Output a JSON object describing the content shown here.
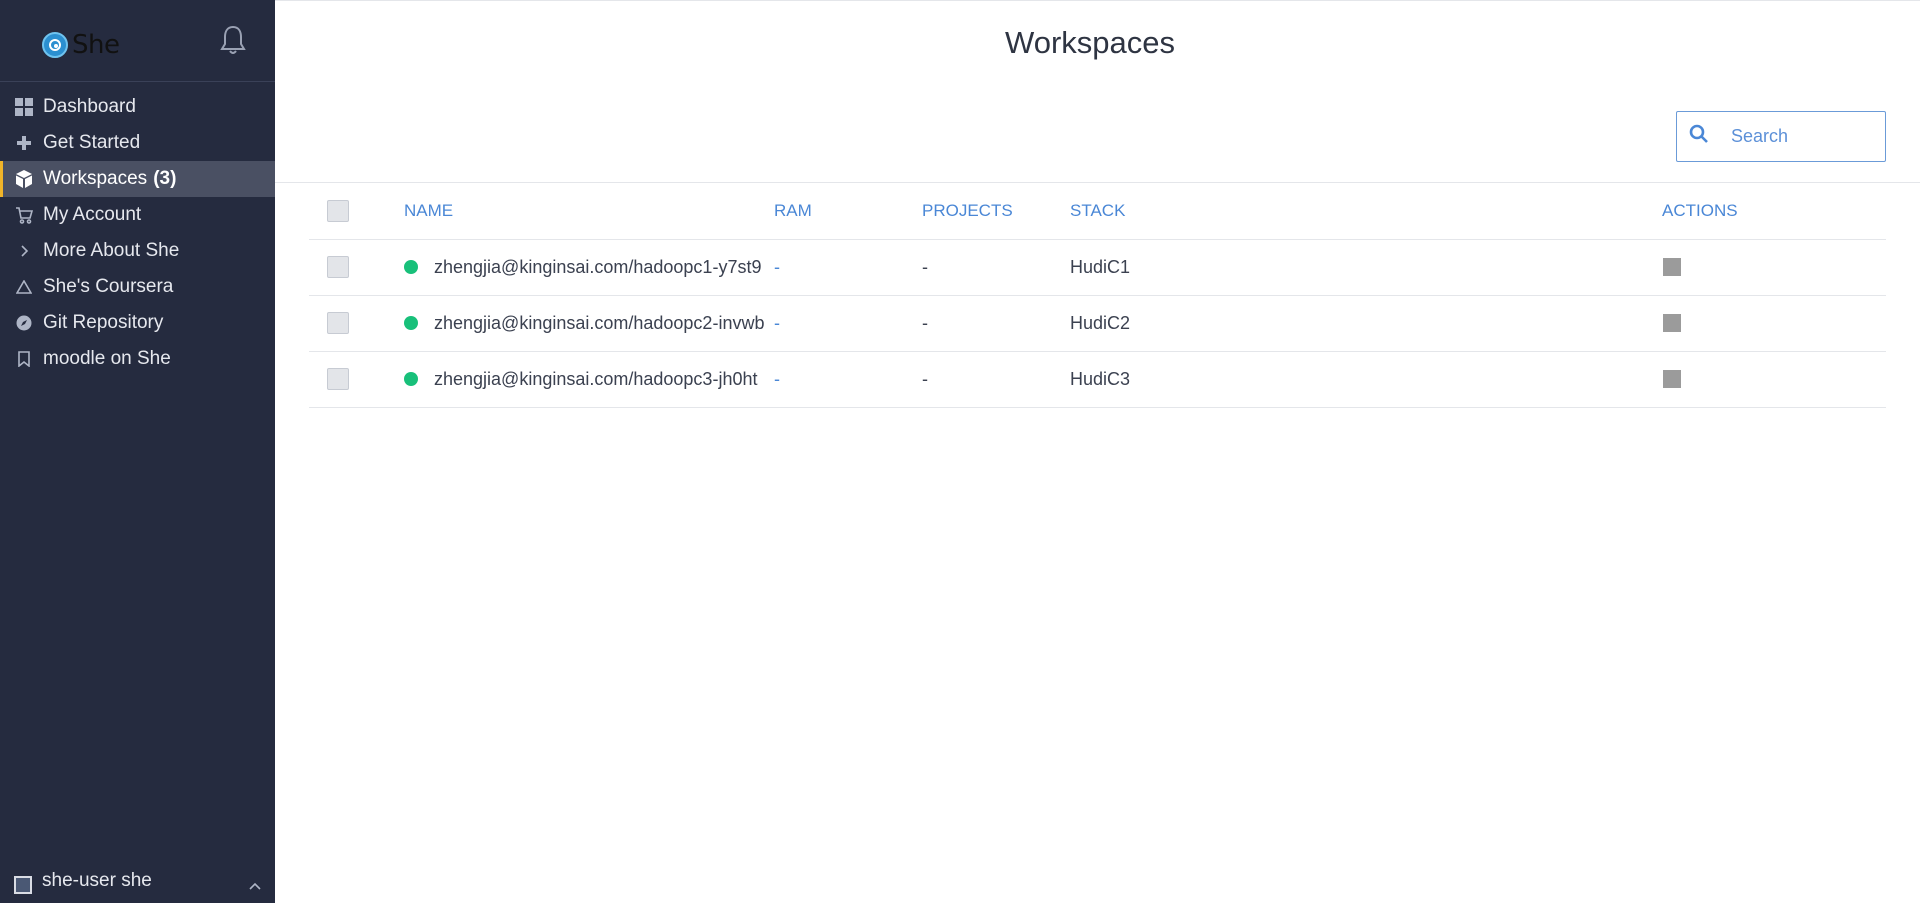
{
  "app": {
    "name": "She"
  },
  "sidebar": {
    "items": [
      {
        "label": "Dashboard",
        "icon": "dashboard-grid-icon"
      },
      {
        "label": "Get Started",
        "icon": "plus-icon"
      },
      {
        "label": "Workspaces",
        "count": "(3)",
        "icon": "cube-icon",
        "active": true
      },
      {
        "label": "My Account",
        "icon": "cart-icon"
      },
      {
        "label": "More About She",
        "icon": "chevron-right-icon"
      },
      {
        "label": "She's Coursera",
        "icon": "triangle-icon"
      },
      {
        "label": "Git Repository",
        "icon": "compass-icon"
      },
      {
        "label": "moodle on She",
        "icon": "bookmark-icon"
      }
    ],
    "user": {
      "name": "she-user she"
    }
  },
  "page": {
    "title": "Workspaces"
  },
  "search": {
    "placeholder": "Search"
  },
  "table": {
    "columns": {
      "name": "NAME",
      "ram": "RAM",
      "projects": "PROJECTS",
      "stack": "STACK",
      "actions": "ACTIONS"
    },
    "rows": [
      {
        "name": "zhengjia@kinginsai.com/hadoopc1-y7st9",
        "ram": "-",
        "projects": "-",
        "stack": "HudiC1",
        "status": "running"
      },
      {
        "name": "zhengjia@kinginsai.com/hadoopc2-invwb",
        "ram": "-",
        "projects": "-",
        "stack": "HudiC2",
        "status": "running"
      },
      {
        "name": "zhengjia@kinginsai.com/hadoopc3-jh0ht",
        "ram": "-",
        "projects": "-",
        "stack": "HudiC3",
        "status": "running"
      }
    ]
  },
  "colors": {
    "sidebar_bg": "#252b3f",
    "accent": "#f0b429",
    "link": "#4a87d6",
    "status_running": "#18c07a"
  }
}
